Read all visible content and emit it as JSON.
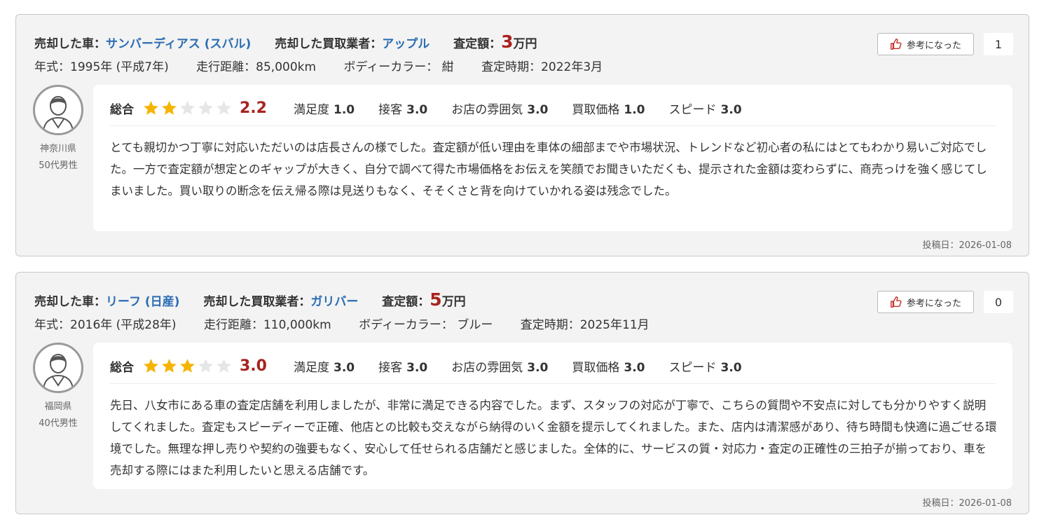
{
  "colors": {
    "accent_link": "#2a6db3",
    "price_red": "#a8231f",
    "star_gold": "#f5b400",
    "star_empty": "#e6e6e6"
  },
  "reviews": [
    {
      "car_label": "売却した車：",
      "car_value": "サンバーディアス (スバル)",
      "dealer_label": "売却した買取業者：",
      "dealer_value": "アップル",
      "price_label": "査定額：",
      "price_value": "3",
      "price_unit": "万円",
      "year": "年式：1995年 (平成7年)",
      "mileage": "走行距離：85,000km",
      "color": "ボディーカラー： 紺",
      "assessed": "査定時期：2022年3月",
      "helpful_label": "参考になった",
      "helpful_count": "1",
      "user_pref": "神奈川県",
      "user_age": "50代男性",
      "overall_label": "総合",
      "overall_value": "2.2",
      "overall_stars": 2,
      "sub_ratings": [
        {
          "label": "満足度",
          "value": "1.0"
        },
        {
          "label": "接客",
          "value": "3.0"
        },
        {
          "label": "お店の雰囲気",
          "value": "3.0"
        },
        {
          "label": "買取価格",
          "value": "1.0"
        },
        {
          "label": "スピード",
          "value": "3.0"
        }
      ],
      "text": "とても親切かつ丁寧に対応いただいのは店長さんの様でした。査定額が低い理由を車体の細部までや市場状況、トレンドなど初心者の私にはとてもわかり易いご対応でした。一方で査定額が想定とのギャップが大きく、自分で調べて得た市場価格をお伝えを笑顔でお聞きいただくも、提示された金額は変わらずに、商売っけを強く感じてしまいました。買い取りの断念を伝え帰る際は見送りもなく、そそくさと背を向けていかれる姿は残念でした。",
      "posted": "投稿日：2026-01-08"
    },
    {
      "car_label": "売却した車：",
      "car_value": "リーフ (日産)",
      "dealer_label": "売却した買取業者：",
      "dealer_value": "ガリバー",
      "price_label": "査定額：",
      "price_value": "5",
      "price_unit": "万円",
      "year": "年式：2016年 (平成28年)",
      "mileage": "走行距離：110,000km",
      "color": "ボディーカラー： ブルー",
      "assessed": "査定時期：2025年11月",
      "helpful_label": "参考になった",
      "helpful_count": "0",
      "user_pref": "福岡県",
      "user_age": "40代男性",
      "overall_label": "総合",
      "overall_value": "3.0",
      "overall_stars": 3,
      "sub_ratings": [
        {
          "label": "満足度",
          "value": "3.0"
        },
        {
          "label": "接客",
          "value": "3.0"
        },
        {
          "label": "お店の雰囲気",
          "value": "3.0"
        },
        {
          "label": "買取価格",
          "value": "3.0"
        },
        {
          "label": "スピード",
          "value": "3.0"
        }
      ],
      "text": "先日、八女市にある車の査定店舗を利用しましたが、非常に満足できる内容でした。まず、スタッフの対応が丁寧で、こちらの質問や不安点に対しても分かりやすく説明してくれました。査定もスピーディーで正確、他店との比較も交えながら納得のいく金額を提示してくれました。また、店内は清潔感があり、待ち時間も快適に過ごせる環境でした。無理な押し売りや契約の強要もなく、安心して任せられる店舗だと感じました。全体的に、サービスの質・対応力・査定の正確性の三拍子が揃っており、車を売却する際にはまた利用したいと思える店舗です。",
      "posted": "投稿日：2026-01-08"
    }
  ]
}
